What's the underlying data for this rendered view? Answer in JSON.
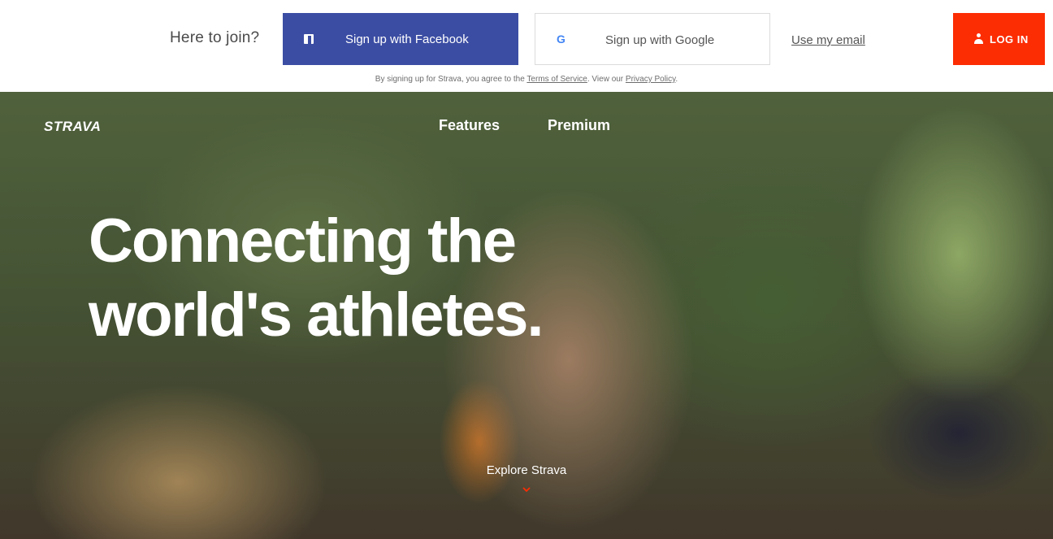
{
  "signup": {
    "join_label": "Here to join?",
    "facebook_label": "Sign up with Facebook",
    "google_label": "Sign up with Google",
    "google_icon_letter": "G",
    "email_label": "Use my email",
    "login_label": "LOG IN",
    "terms_prefix": "By signing up for Strava, you agree to the ",
    "terms_link": "Terms of Service",
    "terms_middle": ". View our ",
    "privacy_link": "Privacy Policy",
    "terms_suffix": "."
  },
  "nav": {
    "logo": "STRAVA",
    "features": "Features",
    "premium": "Premium"
  },
  "hero": {
    "headline_line1": "Connecting the",
    "headline_line2": "world's athletes.",
    "explore_label": "Explore Strava"
  },
  "colors": {
    "facebook": "#3b4da3",
    "login": "#fc2c03",
    "chevron": "#fc2c03"
  }
}
